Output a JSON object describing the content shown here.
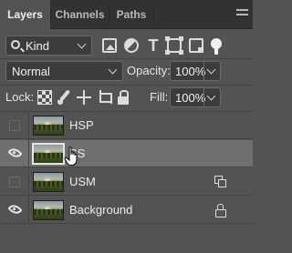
{
  "tabs": [
    {
      "label": "Layers",
      "active": true
    },
    {
      "label": "Channels",
      "active": false
    },
    {
      "label": "Paths",
      "active": false
    }
  ],
  "filter": {
    "kind_label": "Kind",
    "icons": [
      "image-filter-icon",
      "adjustment-filter-icon",
      "type-filter-icon",
      "shape-filter-icon",
      "smart-object-filter-icon",
      "filter-toggle-icon"
    ]
  },
  "blend": {
    "mode": "Normal",
    "opacity_label": "Opacity:",
    "opacity_value": "100%"
  },
  "lock": {
    "label": "Lock:",
    "icons": [
      "lock-transparent-pixels-icon",
      "lock-image-pixels-icon",
      "lock-position-icon",
      "lock-artboard-icon",
      "lock-all-icon"
    ],
    "fill_label": "Fill:",
    "fill_value": "100%"
  },
  "layers": [
    {
      "name": "HSP",
      "visible": false,
      "selected": false,
      "badge": ""
    },
    {
      "name": "SS",
      "visible": true,
      "selected": true,
      "badge": ""
    },
    {
      "name": "USM",
      "visible": false,
      "selected": false,
      "badge": "smart-object"
    },
    {
      "name": "Background",
      "visible": true,
      "selected": false,
      "badge": "lock"
    }
  ],
  "colors": {
    "panel_bg": "#535353",
    "tabbar_bg": "#323232",
    "selected_row": "#6f6f6f",
    "text": "#e6e6e6"
  }
}
